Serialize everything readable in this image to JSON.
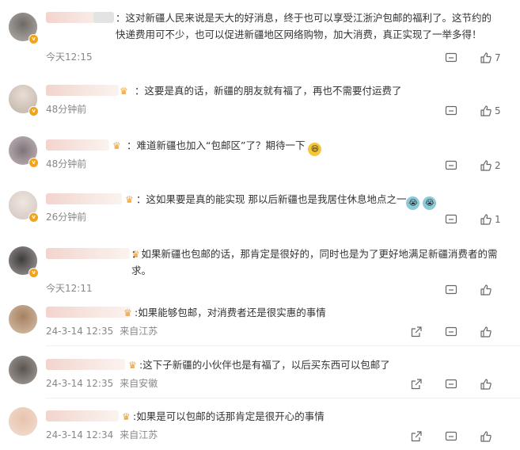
{
  "comments": [
    {
      "text": "：这对新疆人民来说是天大的好消息，终于也可以享受江浙沪包邮的福利了。这节约的快递费用可不少，也可以促进新疆地区网络购物，加大消费，真正实现了一举多得！",
      "time": "今天12:15",
      "source": "",
      "likes": "7"
    },
    {
      "text": "：这要是真的话，新疆的朋友就有福了，再也不需要付运费了",
      "time": "48分钟前",
      "source": "",
      "likes": "5"
    },
    {
      "text": "：难道新疆也加入“包邮区”了？期待一下",
      "time": "48分钟前",
      "source": "",
      "likes": "2"
    },
    {
      "text": "：这如果要是真的能实现 那以后新疆也是我居住休息地点之一",
      "time": "26分钟前",
      "source": "",
      "likes": "1"
    },
    {
      "text": "：如果新疆也包邮的话，那肯定是很好的，同时也是为了更好地满足新疆消费者的需求。",
      "time": "今天12:11",
      "source": "",
      "likes": ""
    },
    {
      "text": ":如果能够包邮，对消费者还是很实惠的事情",
      "time": "24-3-14 12:35",
      "source": "来自江苏",
      "likes": ""
    },
    {
      "text": ":这下子新疆的小伙伴也是有福了，以后买东西可以包邮了",
      "time": "24-3-14 12:35",
      "source": "来自安徽",
      "likes": ""
    },
    {
      "text": ":如果是可以包邮的话那肯定是很开心的事情",
      "time": "24-3-14 12:34",
      "source": "来自江苏",
      "likes": ""
    }
  ],
  "icons": {
    "reply": "comment-icon",
    "share": "share-icon",
    "like": "thumbs-up-icon",
    "emoji_laugh": "laughing-emoji-icon",
    "emoji_cry": "crying-emoji-icon"
  },
  "colors": {
    "text": "#333333",
    "meta": "#888888",
    "badge": "#f2a31d"
  }
}
